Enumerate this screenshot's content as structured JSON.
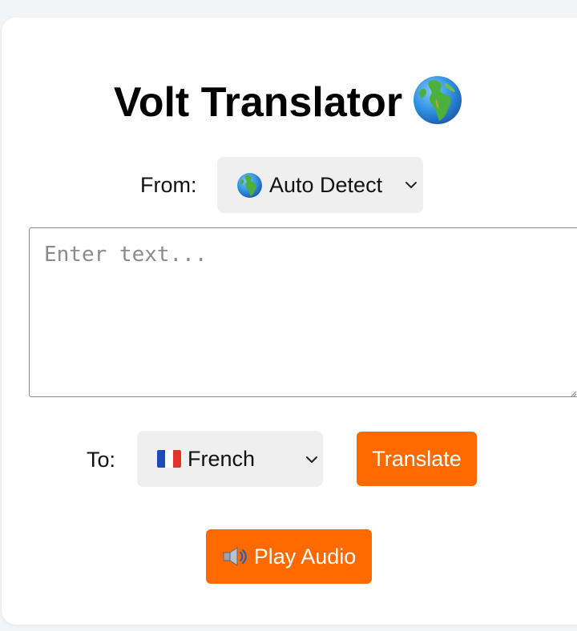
{
  "app": {
    "title": "Volt Translator",
    "title_icon": "globe-europe-africa-icon"
  },
  "from": {
    "label": "From:",
    "selected": "Auto Detect",
    "selected_icon": "globe-icon"
  },
  "input": {
    "placeholder": "Enter text...",
    "value": ""
  },
  "to": {
    "label": "To:",
    "selected": "French",
    "selected_icon": "france-flag-icon"
  },
  "actions": {
    "translate_label": "Translate",
    "play_audio_label": "Play Audio",
    "play_audio_icon": "speaker-icon"
  },
  "colors": {
    "accent": "#ff6a00",
    "select_bg": "#efefef",
    "card_bg": "#ffffff",
    "page_bg": "#f3f4f6"
  }
}
